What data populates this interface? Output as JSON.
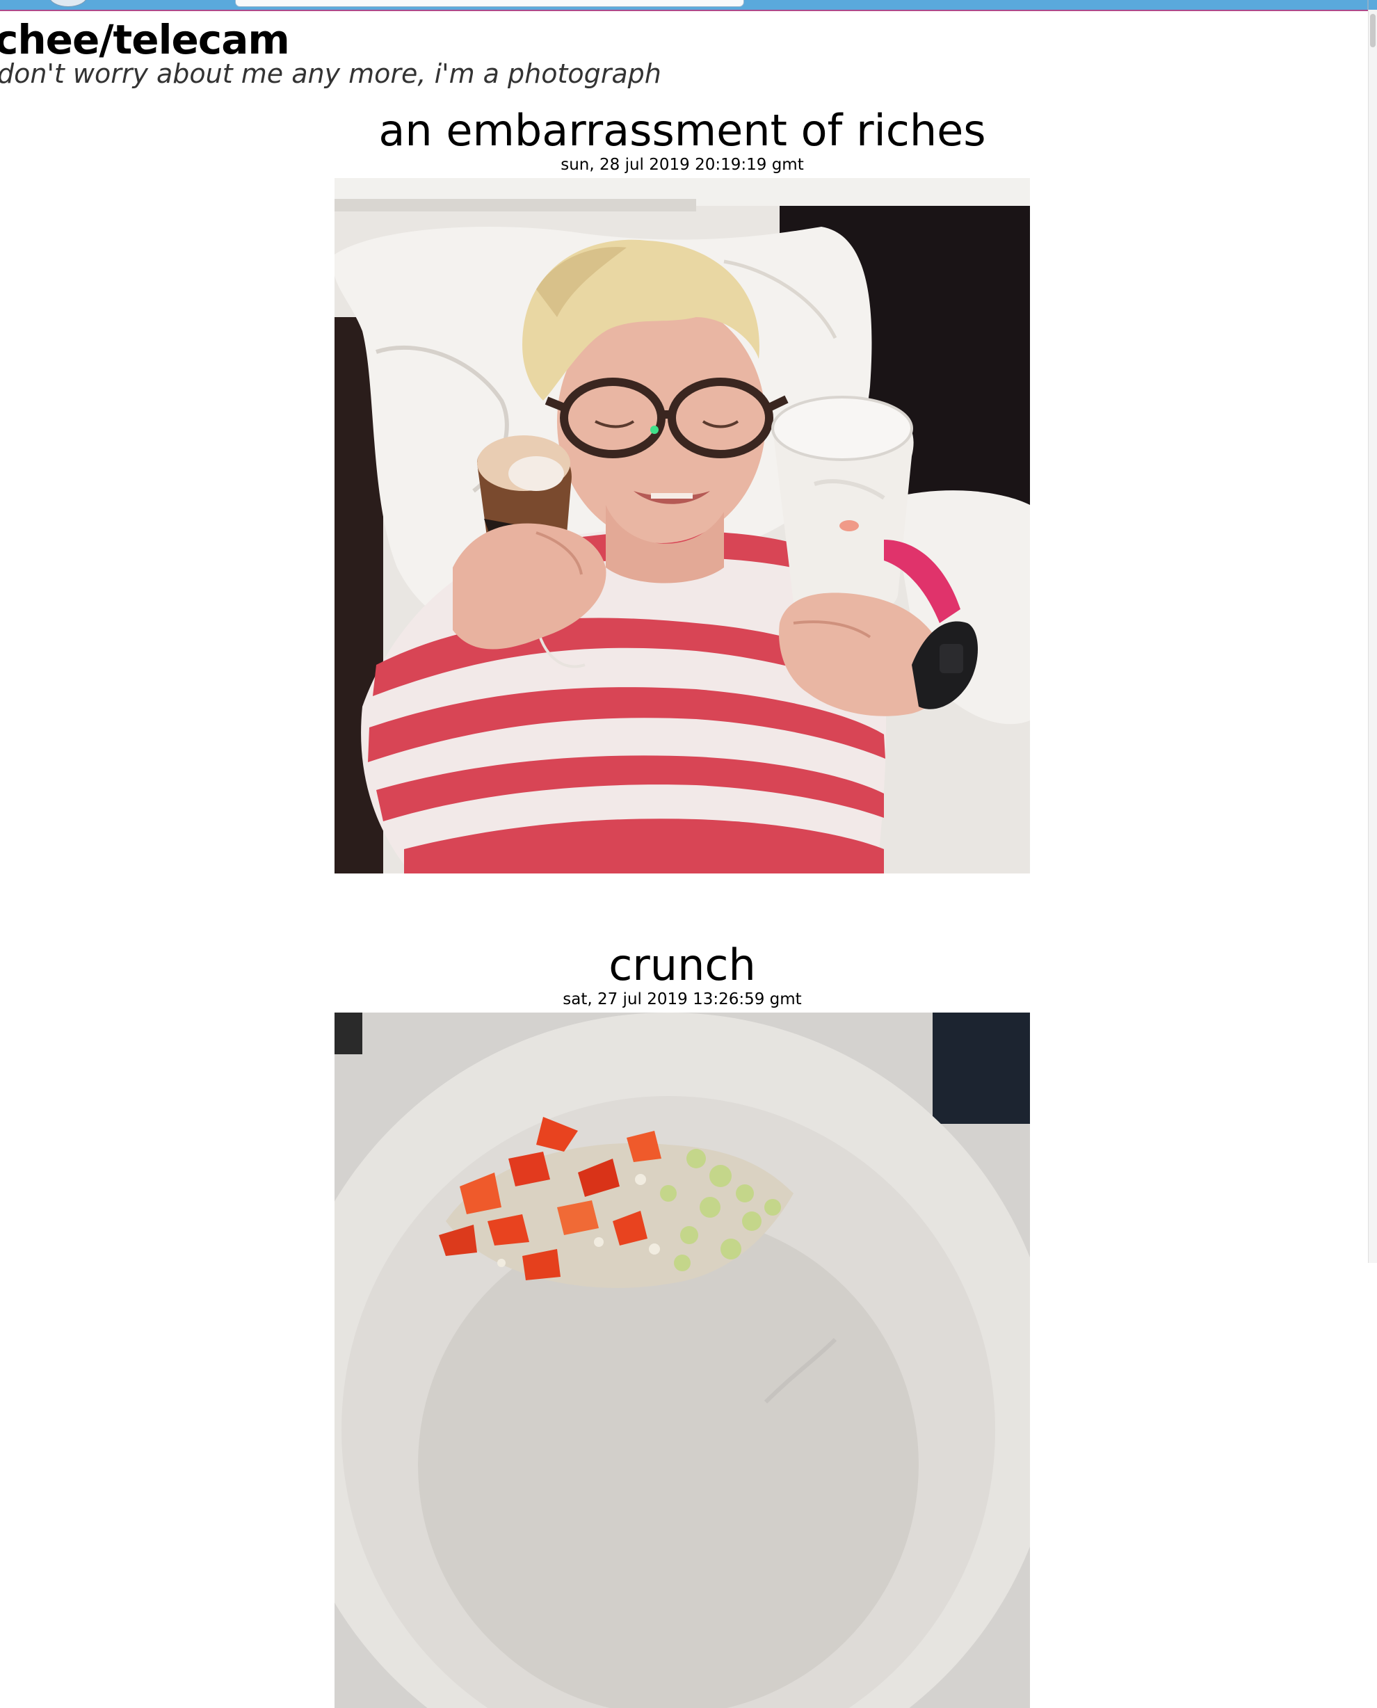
{
  "site": {
    "title": "chee/telecam",
    "tagline": "don't worry about me any more, i'm a photograph"
  },
  "posts": [
    {
      "title": "an embarrassment of riches",
      "date": "sun, 28 jul 2019 20:19:19 gmt",
      "image_alt": "person in striped shirt lying on pillow holding two glasses"
    },
    {
      "title": "crunch",
      "date": "sat, 27 jul 2019 13:26:59 gmt",
      "image_alt": "bowl of chopped red pepper and celery"
    }
  ]
}
